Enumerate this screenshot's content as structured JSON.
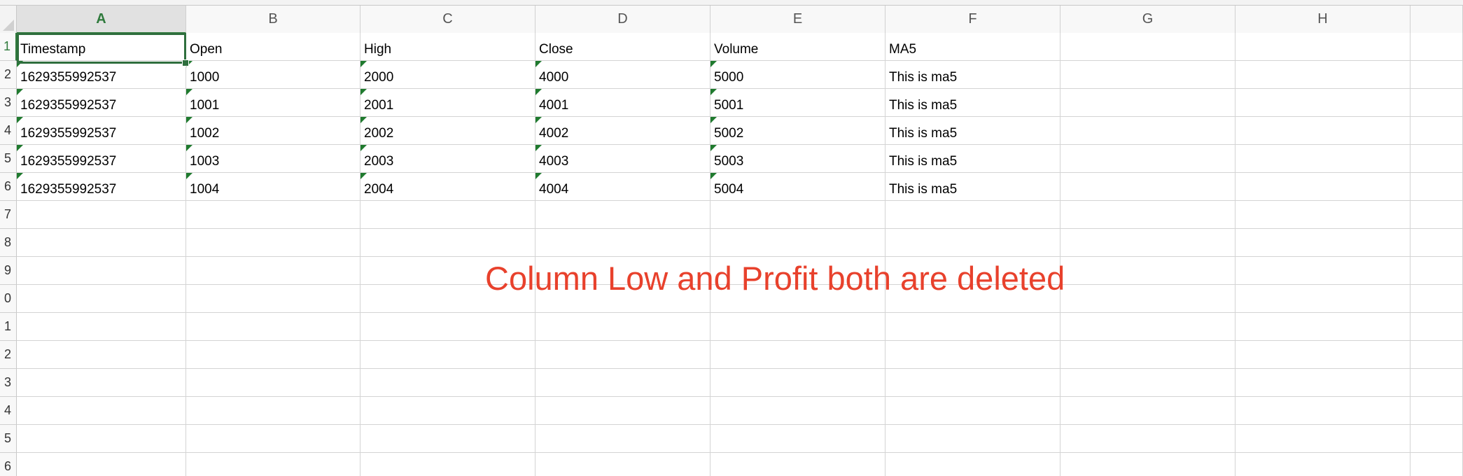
{
  "spreadsheet": {
    "columns": [
      "A",
      "B",
      "C",
      "D",
      "E",
      "F",
      "G",
      "H"
    ],
    "selected_column": "A",
    "selected_row": "1",
    "row_numbers": [
      "1",
      "2",
      "3",
      "4",
      "5",
      "6",
      "7",
      "8",
      "9",
      "0",
      "1",
      "2",
      "3",
      "4",
      "5",
      "6"
    ],
    "header_row": [
      "Timestamp",
      "Open",
      "High",
      "Close",
      "Volume",
      "MA5"
    ],
    "data_rows": [
      [
        "1629355992537",
        "1000",
        "2000",
        "4000",
        "5000",
        "This is ma5"
      ],
      [
        "1629355992537",
        "1001",
        "2001",
        "4001",
        "5001",
        "This is ma5"
      ],
      [
        "1629355992537",
        "1002",
        "2002",
        "4002",
        "5002",
        "This is ma5"
      ],
      [
        "1629355992537",
        "1003",
        "2003",
        "4003",
        "5003",
        "This is ma5"
      ],
      [
        "1629355992537",
        "1004",
        "2004",
        "4004",
        "5004",
        "This is ma5"
      ]
    ]
  },
  "annotation": {
    "text": "Column Low and Profit both are deleted",
    "color": "#e8412c"
  },
  "colors": {
    "selection_green": "#2f6f3e",
    "number_as_text_flag": "#1f7a2e"
  }
}
